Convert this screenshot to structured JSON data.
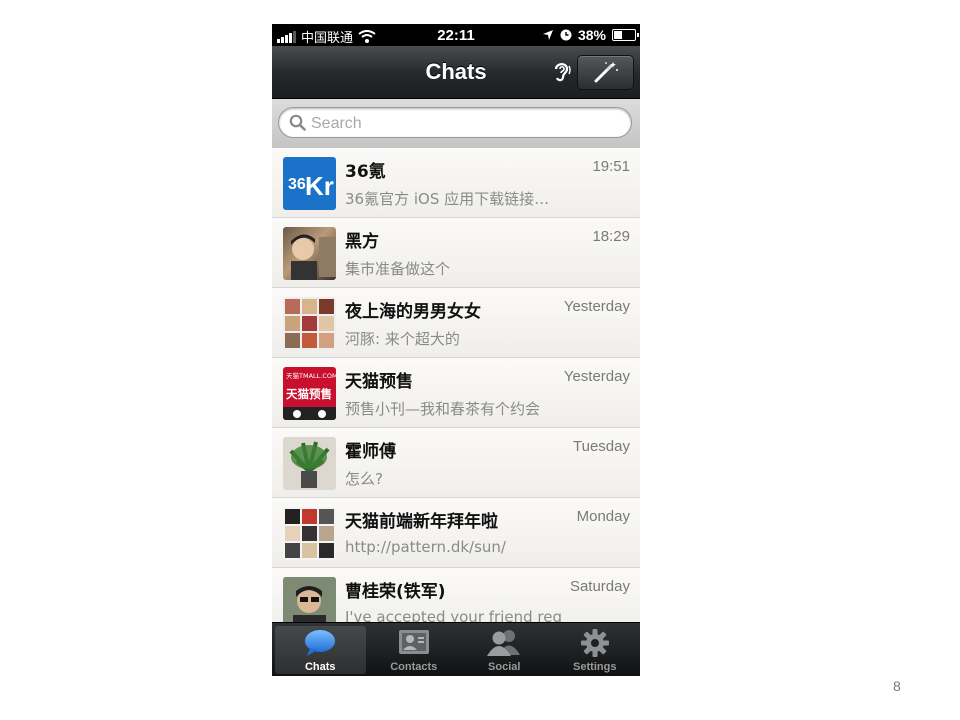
{
  "status_bar": {
    "carrier": "中国联通",
    "time": "22:11",
    "battery": "38%",
    "battery_level": 0.38,
    "icons": [
      "signal-bars-icon",
      "wifi-icon",
      "location-arrow-icon",
      "clock-icon",
      "battery-icon"
    ]
  },
  "navbar": {
    "title": "Chats",
    "icons": [
      "ear-icon",
      "magic-wand-icon"
    ]
  },
  "search": {
    "placeholder": "Search"
  },
  "chats": [
    {
      "name": "36氪",
      "time": "19:51",
      "preview": "36氪官方 iOS 应用下载链接…",
      "avatar_text": "36Kr",
      "avatar_color": "#1a73c8"
    },
    {
      "name": "黑方",
      "time": "18:29",
      "preview": "集市准备做这个"
    },
    {
      "name": "夜上海的男男女女",
      "time": "Yesterday",
      "preview": "河豚: 来个超大的"
    },
    {
      "name": "天猫预售",
      "time": "Yesterday",
      "preview": "预售小刊—我和春茶有个约会",
      "avatar_text": "天猫预售",
      "avatar_small_text": "天猫TMALL.COM",
      "avatar_color": "#c8102e"
    },
    {
      "name": "霍师傅",
      "time": "Tuesday",
      "preview": "怎么?"
    },
    {
      "name": "天猫前端新年拜年啦",
      "time": "Monday",
      "preview": "http://pattern.dk/sun/"
    },
    {
      "name": "曹桂荣(铁军)",
      "time": "Saturday",
      "preview": "I've accepted your friend req"
    }
  ],
  "tabs": [
    {
      "label": "Chats",
      "icon": "chat-bubble-icon",
      "active": true
    },
    {
      "label": "Contacts",
      "icon": "contact-card-icon",
      "active": false
    },
    {
      "label": "Social",
      "icon": "people-icon",
      "active": false
    },
    {
      "label": "Settings",
      "icon": "gear-icon",
      "active": false
    }
  ],
  "colors": {
    "accent_blue": "#3a8ee6",
    "navbar_dark": "#25282a"
  },
  "page_number": "8"
}
